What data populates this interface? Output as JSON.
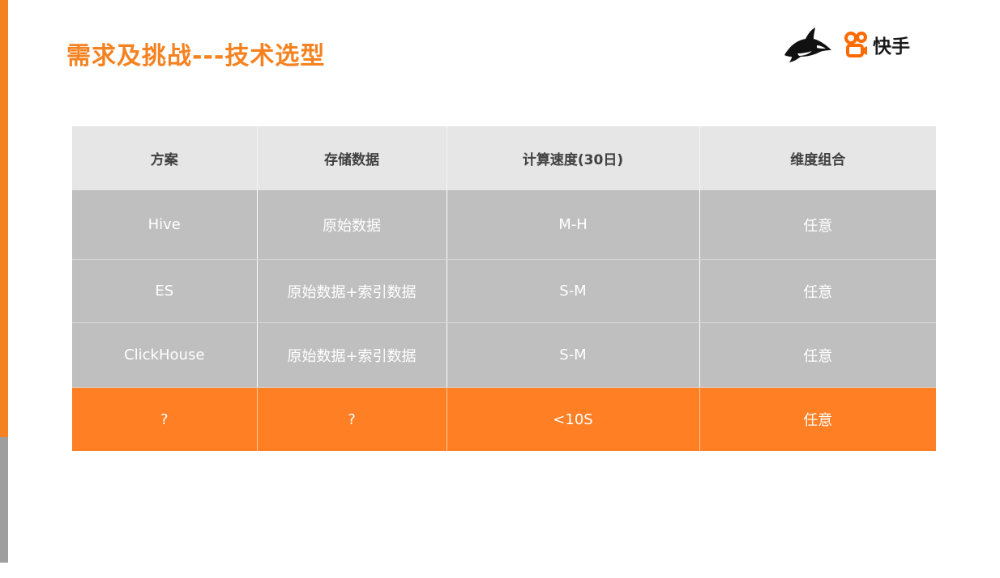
{
  "slide": {
    "title": "需求及挑战---技术选型",
    "brand": "快手",
    "accent_color": "#F58220",
    "secondary_color": "#9E9E9E"
  },
  "icons": [
    "orca-logo-icon",
    "kuaishou-logo-icon"
  ],
  "table": {
    "headers": [
      "方案",
      "存储数据",
      "计算速度(30日)",
      "维度组合"
    ],
    "rows": [
      [
        "Hive",
        "原始数据",
        "M-H",
        "任意"
      ],
      [
        "ES",
        "原始数据+索引数据",
        "S-M",
        "任意"
      ],
      [
        "ClickHouse",
        "原始数据+索引数据",
        "S-M",
        "任意"
      ],
      [
        "?",
        "?",
        "<10S",
        "任意"
      ]
    ],
    "highlight_row_color": "#FF7F24",
    "data_row_color": "#BFBFBF",
    "header_row_color": "#E6E6E6"
  }
}
